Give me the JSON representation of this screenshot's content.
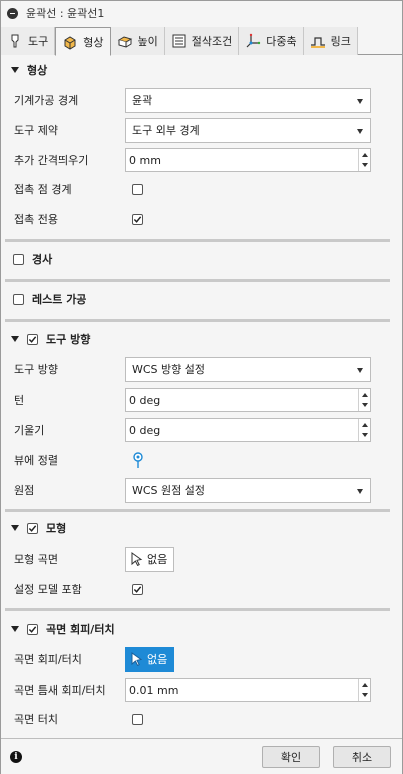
{
  "window": {
    "title": "윤곽선 : 윤곽선1"
  },
  "tabs": [
    {
      "label": "도구",
      "icon": "tool-icon",
      "active": false
    },
    {
      "label": "형상",
      "icon": "geometry-icon",
      "active": true
    },
    {
      "label": "높이",
      "icon": "heights-icon",
      "active": false
    },
    {
      "label": "절삭조건",
      "icon": "passes-icon",
      "active": false
    },
    {
      "label": "다중축",
      "icon": "multiaxis-icon",
      "active": false
    },
    {
      "label": "링크",
      "icon": "linking-icon",
      "active": false
    }
  ],
  "geometry_section": {
    "title": "형상",
    "machining_boundary": {
      "label": "기계가공 경계",
      "value": "윤곽"
    },
    "tool_containment": {
      "label": "도구 제약",
      "value": "도구 외부 경계"
    },
    "additional_offset": {
      "label": "추가 간격띄우기",
      "value": "0 mm"
    },
    "contact_point_boundary": {
      "label": "접촉 점 경계",
      "checked": false
    },
    "contact_only": {
      "label": "접촉 전용",
      "checked": true
    }
  },
  "slope_section": {
    "title": "경사",
    "checked": false
  },
  "rest_section": {
    "title": "레스트 가공",
    "checked": false
  },
  "tool_orientation_section": {
    "title": "도구 방향",
    "checked": true,
    "orientation": {
      "label": "도구 방향",
      "value": "WCS 방향 설정"
    },
    "turn": {
      "label": "턴",
      "value": "0 deg"
    },
    "tilt": {
      "label": "기울기",
      "value": "0 deg"
    },
    "view_align": {
      "label": "뷰에 정렬"
    },
    "origin": {
      "label": "원점",
      "value": "WCS 원점 설정"
    }
  },
  "model_section": {
    "title": "모형",
    "checked": true,
    "model_surfaces": {
      "label": "모형 곡면",
      "button": "없음"
    },
    "include_setup_model": {
      "label": "설정 모델 포함",
      "checked": true
    }
  },
  "avoid_touch_section": {
    "title": "곡면 회피/터치",
    "checked": true,
    "avoid_touch_surfaces": {
      "label": "곡면 회피/터치",
      "button": "없음"
    },
    "surface_clearance": {
      "label": "곡면 틈새 회피/터치",
      "value": "0.01 mm"
    },
    "touch_surfaces": {
      "label": "곡면 터치",
      "checked": false
    }
  },
  "footer": {
    "ok": "확인",
    "cancel": "취소",
    "info_icon": "info-icon"
  },
  "colors": {
    "accent": "#1e8ad6",
    "background": "#f5f5f5"
  }
}
